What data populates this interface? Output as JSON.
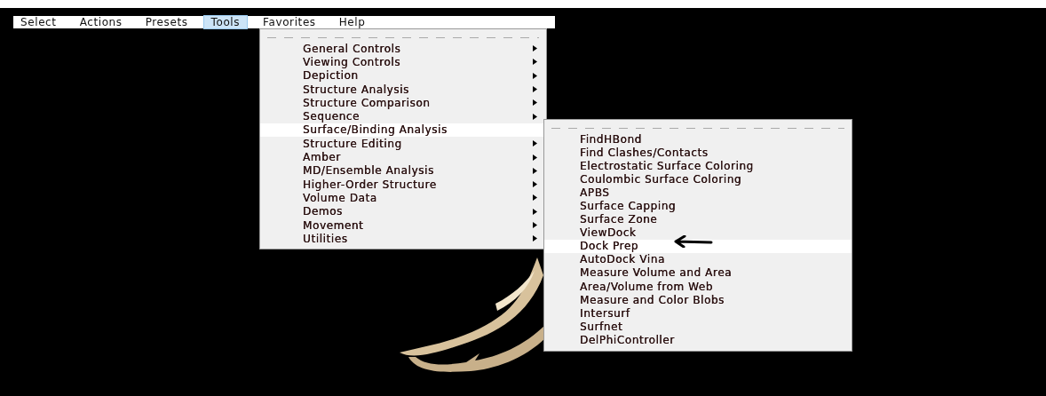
{
  "menubar": [
    {
      "label": "Select",
      "selected": false
    },
    {
      "label": "Actions",
      "selected": false
    },
    {
      "label": "Presets",
      "selected": false
    },
    {
      "label": "Tools",
      "selected": true
    },
    {
      "label": "Favorites",
      "selected": false
    },
    {
      "label": "Help",
      "selected": false
    }
  ],
  "tools_menu": {
    "items": [
      {
        "label": "General Controls",
        "selected": false,
        "arrow": true
      },
      {
        "label": "Viewing Controls",
        "selected": false,
        "arrow": true
      },
      {
        "label": "Depiction",
        "selected": false,
        "arrow": true
      },
      {
        "label": "Structure Analysis",
        "selected": false,
        "arrow": true
      },
      {
        "label": "Structure Comparison",
        "selected": false,
        "arrow": true
      },
      {
        "label": "Sequence",
        "selected": false,
        "arrow": true
      },
      {
        "label": "Surface/Binding Analysis",
        "selected": true,
        "arrow": false
      },
      {
        "label": "Structure Editing",
        "selected": false,
        "arrow": true
      },
      {
        "label": "Amber",
        "selected": false,
        "arrow": true
      },
      {
        "label": "MD/Ensemble Analysis",
        "selected": false,
        "arrow": true
      },
      {
        "label": "Higher-Order Structure",
        "selected": false,
        "arrow": true
      },
      {
        "label": "Volume Data",
        "selected": false,
        "arrow": true
      },
      {
        "label": "Demos",
        "selected": false,
        "arrow": true
      },
      {
        "label": "Movement",
        "selected": false,
        "arrow": true
      },
      {
        "label": "Utilities",
        "selected": false,
        "arrow": true
      }
    ]
  },
  "surface_submenu": {
    "items": [
      {
        "label": "FindHBond",
        "selected": false
      },
      {
        "label": "Find Clashes/Contacts",
        "selected": false
      },
      {
        "label": "Electrostatic Surface Coloring",
        "selected": false
      },
      {
        "label": "Coulombic Surface Coloring",
        "selected": false
      },
      {
        "label": "APBS",
        "selected": false
      },
      {
        "label": "Surface Capping",
        "selected": false
      },
      {
        "label": "Surface Zone",
        "selected": false
      },
      {
        "label": "ViewDock",
        "selected": false
      },
      {
        "label": "Dock Prep",
        "selected": true
      },
      {
        "label": "AutoDock Vina",
        "selected": false
      },
      {
        "label": "Measure Volume and Area",
        "selected": false
      },
      {
        "label": "Area/Volume from Web",
        "selected": false
      },
      {
        "label": "Measure and Color Blobs",
        "selected": false
      },
      {
        "label": "Intersurf",
        "selected": false
      },
      {
        "label": "Surfnet",
        "selected": false
      },
      {
        "label": "DelPhiController",
        "selected": false
      }
    ]
  }
}
